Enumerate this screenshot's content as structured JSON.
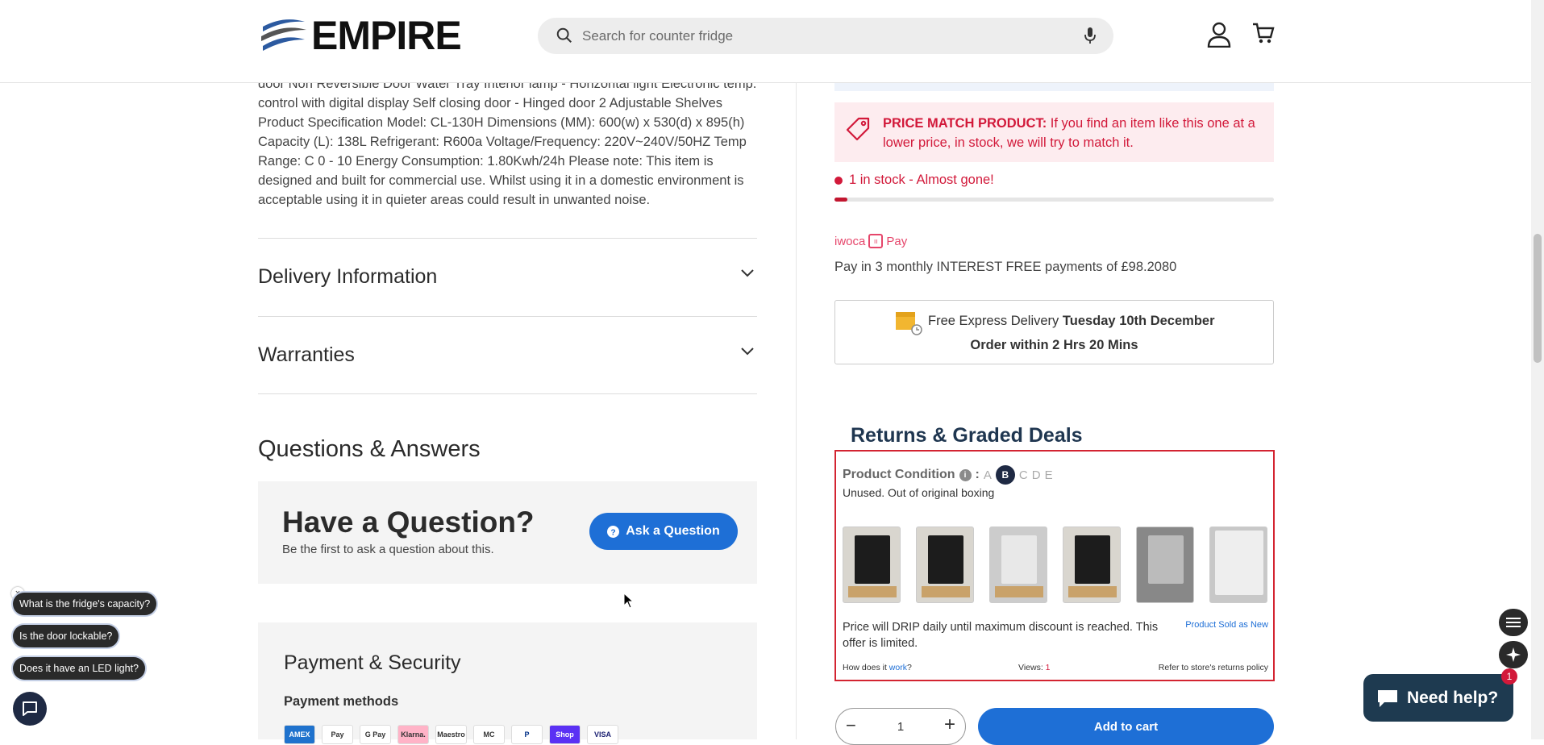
{
  "header": {
    "logo_text": "EMPIRE",
    "search_placeholder": "Search for counter fridge"
  },
  "description": {
    "text": "door Non Reversible Door Water Tray Interior lamp - Horizontal light Electronic temp. control with digital display Self closing door - Hinged door 2 Adjustable Shelves Product Specification Model: CL-130H Dimensions (MM): 600(w) x 530(d) x 895(h) Capacity (L): 138L Refrigerant: R600a Voltage/Frequency: 220V~240V/50HZ Temp Range: C 0 - 10 Energy Consumption: 1.80Kwh/24h Please note: This item is designed and built for commercial use. Whilst using it in a domestic environment is acceptable using it in quieter areas could result in unwanted noise."
  },
  "accordions": [
    {
      "label": "Delivery Information"
    },
    {
      "label": "Warranties"
    }
  ],
  "qa": {
    "title": "Questions & Answers",
    "heading": "Have a Question?",
    "subtext": "Be the first to ask a question about this.",
    "ask_button": "Ask a Question"
  },
  "payment": {
    "title": "Payment & Security",
    "methods_label": "Payment methods",
    "methods": [
      "AMEX",
      "Pay",
      "G Pay",
      "Klarna.",
      "Maestro",
      "MC",
      "P",
      "Shop",
      "VISA"
    ]
  },
  "price_match": {
    "bold": "PRICE MATCH PRODUCT:",
    "text": " If you find an item like this one at a lower price, in stock, we will try to match it."
  },
  "stock": {
    "text": "1 in stock - Almost gone!",
    "fill_percent": 3
  },
  "iwoca": {
    "brand": "iwoca",
    "pay": "Pay",
    "installments": "Pay in 3 monthly INTEREST FREE payments of £98.2080"
  },
  "delivery": {
    "line1_normal": "Free Express Delivery ",
    "line1_bold": "Tuesday 10th December",
    "line2": "Order within 2 Hrs 20 Mins"
  },
  "returns": {
    "title": "Returns & Graded Deals",
    "condition_label": "Product Condition",
    "grades": [
      "A",
      "B",
      "C",
      "D",
      "E"
    ],
    "selected_grade": "B",
    "condition_text": "Unused. Out of original boxing",
    "drip_text": "Price will DRIP daily until maximum discount is reached. This offer is limited.",
    "sold_as_new": "Product Sold as New",
    "how_prefix": "How does it ",
    "how_link": "work",
    "how_suffix": "?",
    "views_label": "Views: ",
    "views_value": "1",
    "refer_text": "Refer to store's returns policy"
  },
  "cart": {
    "quantity": "1",
    "minus": "−",
    "plus": "+",
    "add_to_cart": "Add to cart"
  },
  "chat": {
    "suggestions": [
      "What is the fridge's capacity?",
      "Is the door lockable?",
      "Does it have an LED light?"
    ],
    "close": "×"
  },
  "help": {
    "label": "Need help?",
    "badge": "1"
  },
  "colors": {
    "primary_blue": "#1e6fd6",
    "alert_red": "#d2193a",
    "navy": "#1f3650"
  }
}
